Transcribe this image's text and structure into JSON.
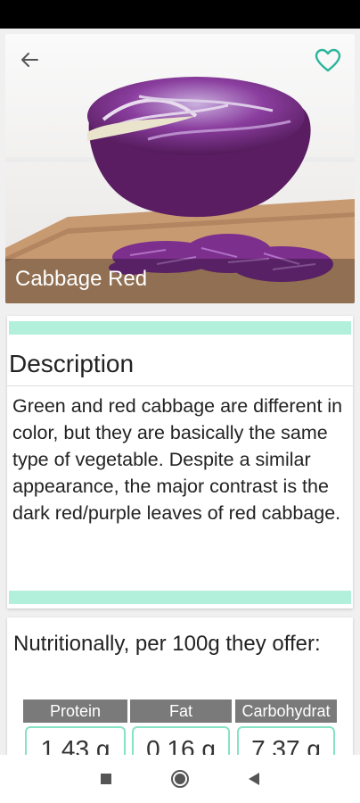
{
  "hero": {
    "title": "Cabbage Red",
    "back_icon": "arrow-left-icon",
    "favorite_icon": "heart-outline-icon",
    "accent_color": "#2bb59a"
  },
  "description": {
    "title": "Description",
    "text": "Green and red cabbage are different in color, but they are basically the same type of vegetable. Despite a similar appearance, the major contrast is the dark red/purple leaves of red cabbage.",
    "accent_color": "#b2f0dc"
  },
  "nutrition": {
    "title": "Nutritionally, per 100g they offer:",
    "items": [
      {
        "label": "Protein",
        "value": "1.43 g"
      },
      {
        "label": "Fat",
        "value": "0.16 g"
      },
      {
        "label": "Carbohydrat",
        "value": "7.37 g"
      }
    ]
  },
  "navbar": {
    "icons": [
      "square-recents-icon",
      "circle-home-icon",
      "triangle-back-icon"
    ]
  }
}
